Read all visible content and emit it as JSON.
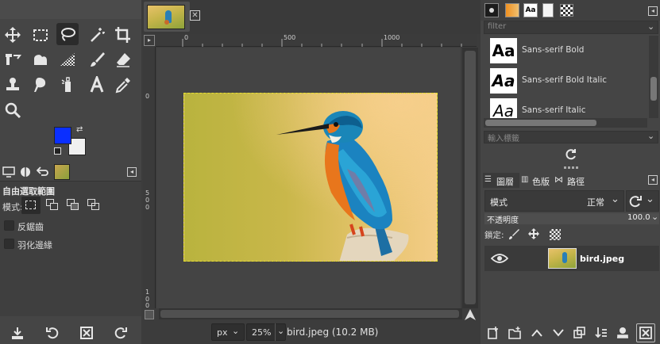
{
  "toolbox": {
    "tool_options_tabs": [
      "tool-options-tab",
      "device-status-tab",
      "undo-history-tab",
      "images-tab"
    ],
    "tool_options_title": "自由選取範圍",
    "mode_label": "模式:",
    "antialias_label": "反鋸齒",
    "feather_label": "羽化邊緣"
  },
  "colors": {
    "foreground": "#0a2fff",
    "background": "#f0f0f0"
  },
  "image_tab": {
    "close_symbol": "⊠"
  },
  "rulers": {
    "h_labels": [
      "0",
      "500",
      "1000"
    ],
    "v_labels": [
      "0",
      "5",
      "0",
      "0",
      "1",
      "0",
      "0",
      "0"
    ],
    "v_label_top": [
      "0",
      "5",
      "0",
      "0"
    ],
    "v_label_bottom": [
      "1",
      "0",
      "0",
      "0"
    ]
  },
  "statusbar": {
    "unit": "px",
    "zoom": "25",
    "zoom_suffix": "%",
    "file_info": "bird.jpeg (10.2 MB)"
  },
  "fonts_panel": {
    "filter_placeholder": "filter",
    "fonts": [
      {
        "preview": "Aa",
        "name": "Sans-serif Bold"
      },
      {
        "preview": "Aa",
        "name": "Sans-serif Bold Italic"
      },
      {
        "preview": "Aa",
        "name": "Sans-serif Italic"
      }
    ],
    "tag_placeholder": "輸入標籤"
  },
  "layers_panel": {
    "tabs": [
      {
        "label": "圖層"
      },
      {
        "label": "色版"
      },
      {
        "label": "路徑"
      }
    ],
    "mode_label": "模式",
    "mode_value": "正常",
    "opacity_label": "不透明度",
    "opacity_value": "100.0",
    "lock_label": "鎖定:",
    "layers": [
      {
        "name": "bird.jpeg"
      }
    ]
  }
}
